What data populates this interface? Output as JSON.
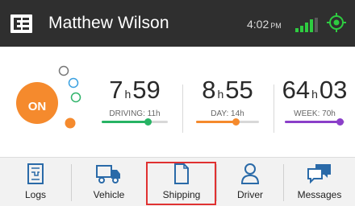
{
  "header": {
    "logo_icon": "eld-logo-icon",
    "title": "Matthew Wilson",
    "time": "4:02",
    "ampm": "PM",
    "signal_icon": "signal-bars-icon",
    "gps_icon": "gps-locate-icon"
  },
  "status": {
    "duty_status": "ON",
    "colors": {
      "on": "#f58a2d",
      "driving": "#27b364",
      "day": "#f58a2d",
      "week": "#8b3fc9"
    }
  },
  "metrics": [
    {
      "hours": "7",
      "h": "h",
      "minutes": "59",
      "caption": "DRIVING: 11h",
      "progress": 0.7
    },
    {
      "hours": "8",
      "h": "h",
      "minutes": "55",
      "caption": "DAY: 14h",
      "progress": 0.64
    },
    {
      "hours": "64",
      "h": "h",
      "minutes": "03",
      "caption": "WEEK: 70h",
      "progress": 0.92
    }
  ],
  "nav": {
    "items": [
      {
        "label": "Logs",
        "icon": "logs-icon"
      },
      {
        "label": "Vehicle",
        "icon": "truck-icon"
      },
      {
        "label": "Shipping",
        "icon": "document-icon"
      },
      {
        "label": "Driver",
        "icon": "person-icon"
      },
      {
        "label": "Messages",
        "icon": "chat-icon"
      }
    ],
    "selected": "Shipping",
    "highlight_color": "#e03131"
  }
}
